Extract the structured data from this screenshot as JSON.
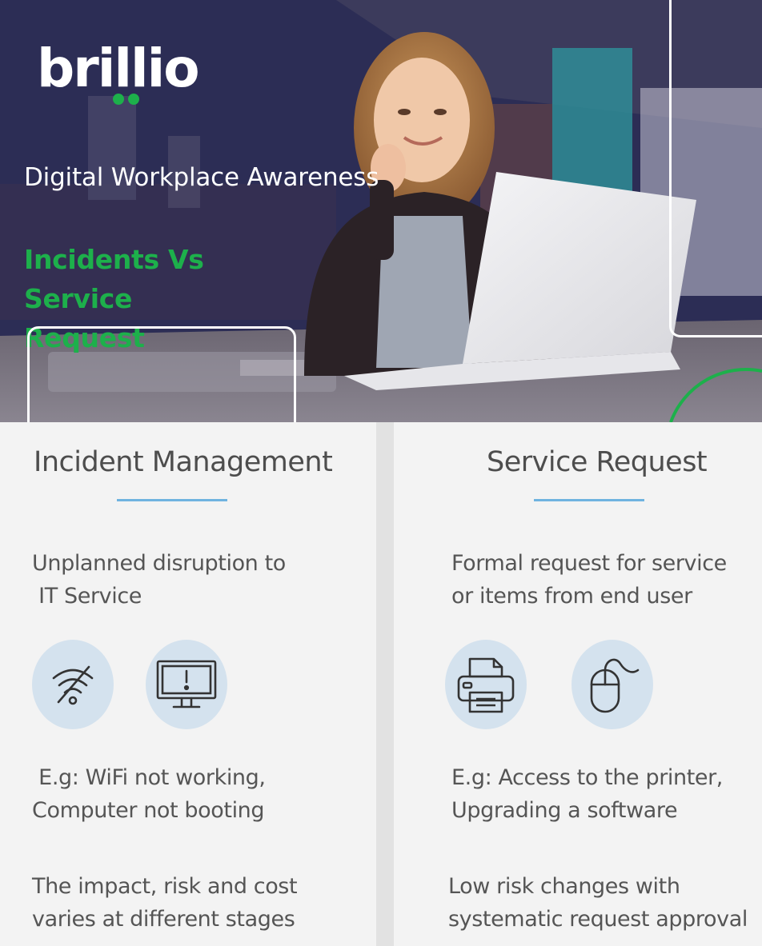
{
  "hero": {
    "logo_text": "brillio",
    "title": "Digital Workplace Awareness",
    "subtitle_line1": "Incidents Vs Service",
    "subtitle_line2": "Request"
  },
  "incident": {
    "title": "Incident Management",
    "description_line1": "Unplanned disruption to",
    "description_line2": " IT Service",
    "icons": [
      "wifi-off-icon",
      "monitor-alert-icon"
    ],
    "example_line1": " E.g: WiFi not working,",
    "example_line2": "Computer not booting",
    "note_line1": "The impact, risk and cost",
    "note_line2": "varies at different stages"
  },
  "service": {
    "title": "Service Request",
    "description_line1": "Formal request for service",
    "description_line2": "or items from end user",
    "icons": [
      "printer-icon",
      "mouse-icon"
    ],
    "example_line1": "E.g: Access to the printer,",
    "example_line2": "Upgrading a software",
    "note_line1": "Low risk changes with",
    "note_line2": "systematic request approval"
  },
  "colors": {
    "brand_green": "#1db04b",
    "accent_blue": "#6fb3e0",
    "icon_circle": "#d4e2ee",
    "text_gray": "#555555"
  }
}
